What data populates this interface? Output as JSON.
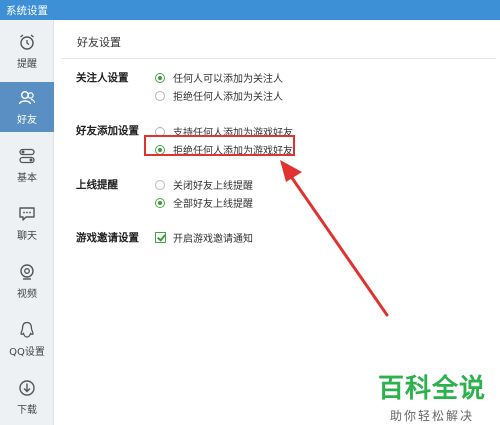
{
  "window": {
    "title": "系统设置"
  },
  "sidebar": {
    "items": [
      {
        "label": "提醒",
        "icon": "alarm-clock-icon",
        "active": false
      },
      {
        "label": "好友",
        "icon": "users-icon",
        "active": true
      },
      {
        "label": "基本",
        "icon": "toggle-settings-icon",
        "active": false
      },
      {
        "label": "聊天",
        "icon": "chat-bubble-icon",
        "active": false
      },
      {
        "label": "视频",
        "icon": "camera-icon",
        "active": false
      },
      {
        "label": "QQ设置",
        "icon": "qq-penguin-icon",
        "active": false
      },
      {
        "label": "下载",
        "icon": "download-icon",
        "active": false
      }
    ]
  },
  "main": {
    "section_title": "好友设置",
    "groups": [
      {
        "label": "关注人设置",
        "options": [
          {
            "text": "任何人可以添加为关注人",
            "checked": true
          },
          {
            "text": "拒绝任何人添加为关注人",
            "checked": false
          }
        ]
      },
      {
        "label": "好友添加设置",
        "options": [
          {
            "text": "支持任何人添加为游戏好友",
            "checked": false
          },
          {
            "text": "拒绝任何人添加为游戏好友",
            "checked": true
          }
        ]
      },
      {
        "label": "上线提醒",
        "options": [
          {
            "text": "关闭好友上线提醒",
            "checked": false
          },
          {
            "text": "全部好友上线提醒",
            "checked": true
          }
        ]
      },
      {
        "label": "游戏邀请设置",
        "options": [
          {
            "text": "开启游戏邀请通知",
            "checked": true
          }
        ]
      }
    ]
  },
  "annotation": {
    "color": "#e0322e"
  },
  "watermark": {
    "title": "百科全说",
    "subtitle": "助你轻松解决"
  },
  "colors": {
    "titlebar": "#3d8fd6",
    "sidebar_active": "#5a8fc4",
    "accent_green": "#3d9a3a",
    "watermark_green": "#2bb24c"
  }
}
